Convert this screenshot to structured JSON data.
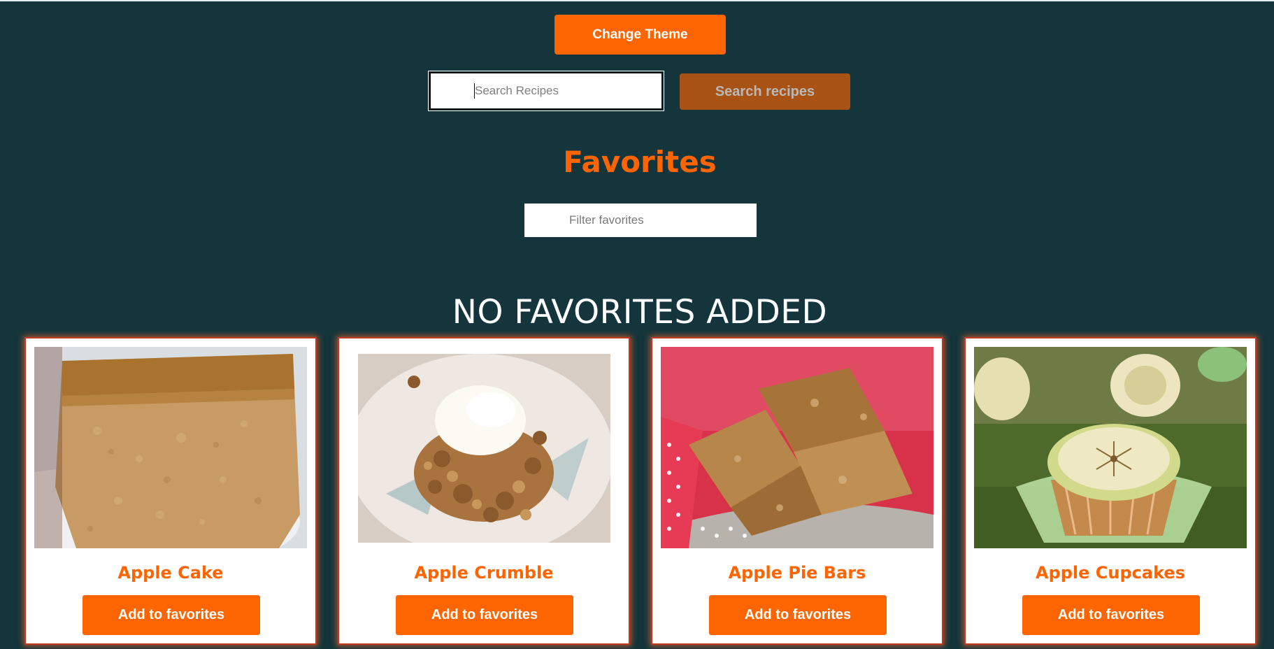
{
  "header": {
    "change_theme_label": "Change Theme"
  },
  "search": {
    "placeholder": "Search Recipes",
    "value": "",
    "button_label": "Search recipes"
  },
  "favorites": {
    "title": "Favorites",
    "filter_placeholder": "Filter favorites",
    "empty_message": "NO FAVORITES ADDED"
  },
  "recipes": [
    {
      "title": "Apple Cake",
      "button_label": "Add to favorites",
      "image": "apple-cake-photo"
    },
    {
      "title": "Apple Crumble",
      "button_label": "Add to favorites",
      "image": "apple-crumble-photo"
    },
    {
      "title": "Apple Pie Bars",
      "button_label": "Add to favorites",
      "image": "apple-pie-bars-photo"
    },
    {
      "title": "Apple Cupcakes",
      "button_label": "Add to favorites",
      "image": "apple-cupcakes-photo"
    }
  ],
  "colors": {
    "background": "#14353c",
    "accent": "#fd6502",
    "search_button": "#a85215",
    "card_border": "#c0391f"
  }
}
